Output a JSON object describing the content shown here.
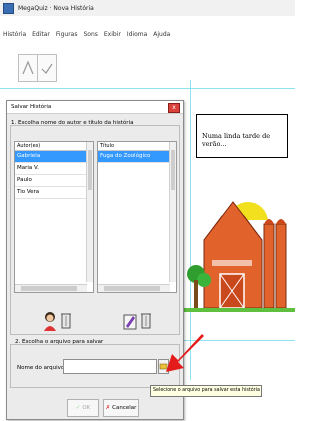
{
  "window": {
    "title": "MegaQuiz · Nova História"
  },
  "menu": [
    "História",
    "Editar",
    "Figuras",
    "Sons",
    "Exibir",
    "Idioma",
    "Ajuda"
  ],
  "story": {
    "text": "Numa linda tarde de verão..."
  },
  "dialog": {
    "title": "Salvar História",
    "close": "x",
    "step1_label": "1. Escolha nome do autor e título da história",
    "authors": {
      "header": "Autor(es)",
      "items": [
        "Gabriela",
        "Maria V.",
        "Paulo",
        "Tio Vera"
      ],
      "selected_index": 0
    },
    "titles": {
      "header": "Título",
      "items": [
        "Fuga do Zoológico"
      ],
      "selected_index": 0
    },
    "step2_label": "2. Escolha o arquivo para salvar",
    "name_label": "Nome do arquivo",
    "name_value": "",
    "ok_label": "OK",
    "cancel_label": "Cancelar"
  },
  "tooltip": "Selecione o arquivo para salvar esta história",
  "icons": {
    "author_add": "person-icon",
    "author_delete": "trash-icon",
    "title_add": "pencil-icon",
    "title_delete": "trash-icon",
    "browse": "folder-icon",
    "pointer": "red-arrow-icon"
  },
  "colors": {
    "selection": "#3399ff",
    "barn": "#e2622b",
    "sun": "#f2e01e",
    "tree": "#2f9e2f"
  }
}
